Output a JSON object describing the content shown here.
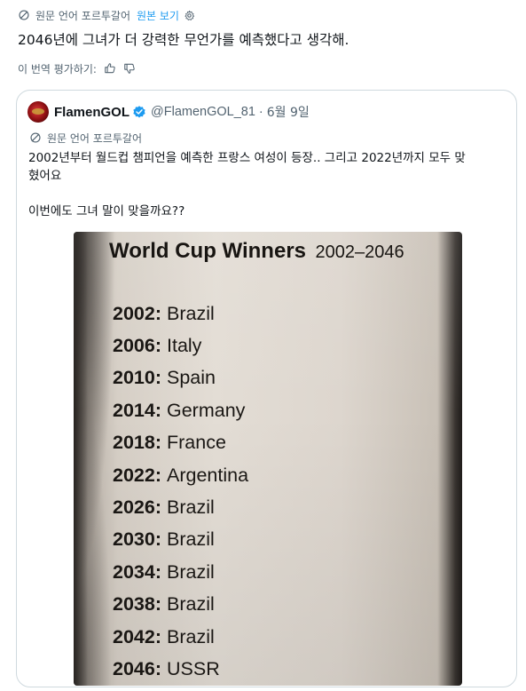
{
  "translation_bar": {
    "source_language": "원문 언어 포르투갈어",
    "show_original": "원본 보기"
  },
  "tweet_text": "2046년에 그녀가 더 강력한 무언가를 예측했다고 생각해.",
  "rate_translation": "이 번역 평가하기:",
  "quote": {
    "name": "FlamenGOL",
    "handle": "@FlamenGOL_81",
    "separator": "·",
    "date": "6월 9일",
    "source_language": "원문 언어 포르투갈어",
    "text_line1": "2002년부터 월드컵 챔피언을 예측한 프랑스 여성이 등장.. 그리고 2022년까지 모두 맞",
    "text_line2": "혔어요",
    "text_line3": "이번에도 그녀 말이 맞을까요??"
  },
  "photo": {
    "title": "World Cup Winners",
    "range": "2002–2046",
    "winners": [
      {
        "year": "2002:",
        "country": "Brazil"
      },
      {
        "year": "2006:",
        "country": "Italy"
      },
      {
        "year": "2010:",
        "country": "Spain"
      },
      {
        "year": "2014:",
        "country": "Germany"
      },
      {
        "year": "2018:",
        "country": "France"
      },
      {
        "year": "2022:",
        "country": "Argentina"
      },
      {
        "year": "2026:",
        "country": "Brazil"
      },
      {
        "year": "2030:",
        "country": "Brazil"
      },
      {
        "year": "2034:",
        "country": "Brazil"
      },
      {
        "year": "2038:",
        "country": "Brazil"
      },
      {
        "year": "2042:",
        "country": "Brazil"
      },
      {
        "year": "2046:",
        "country": "USSR"
      }
    ]
  },
  "icons": {
    "translate": "translate-icon",
    "settings": "gear-icon",
    "thumbs_up": "thumbs-up-icon",
    "thumbs_down": "thumbs-down-icon",
    "verified": "verified-badge-icon"
  },
  "colors": {
    "link": "#1d9bf0",
    "secondary_text": "#536471",
    "border": "#cfd9de",
    "verified": "#1d9bf0"
  }
}
